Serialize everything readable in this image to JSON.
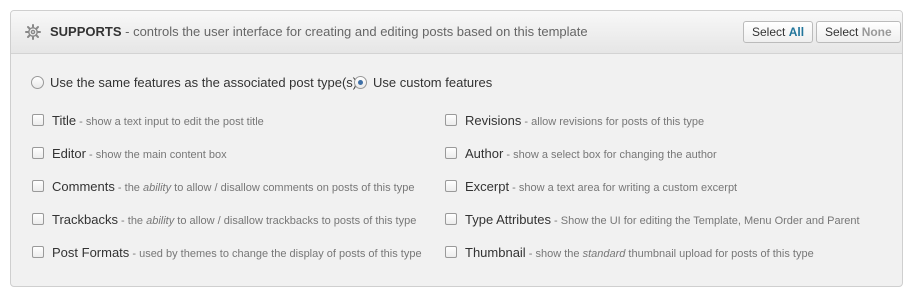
{
  "header": {
    "icon": "gear-icon",
    "title": "SUPPORTS",
    "subtitle": " - controls the user interface for creating and editing posts based on this template",
    "select_all": {
      "prefix": "Select ",
      "accent": "All"
    },
    "select_none": {
      "prefix": "Select ",
      "accent": "None"
    }
  },
  "radios": [
    {
      "label": "Use the same features as the associated post type(s)",
      "checked": false
    },
    {
      "label": "Use custom features",
      "checked": true
    }
  ],
  "options": {
    "title": {
      "label": "Title",
      "desc": " - show a text input to edit the post title"
    },
    "editor": {
      "label": "Editor",
      "desc": " - show the main content box"
    },
    "comments": {
      "label": "Comments",
      "desc_a": " - the ",
      "desc_em": "ability",
      "desc_b": " to allow / disallow comments on posts of this type"
    },
    "trackbacks": {
      "label": "Trackbacks",
      "desc_a": " - the ",
      "desc_em": "ability",
      "desc_b": " to allow / disallow trackbacks to posts of this type"
    },
    "post_formats": {
      "label": "Post Formats",
      "desc": " - used by themes to change the display of posts of this type"
    },
    "revisions": {
      "label": "Revisions",
      "desc": " - allow revisions for posts of this type"
    },
    "author": {
      "label": "Author",
      "desc": " - show a select box for changing the author"
    },
    "excerpt": {
      "label": "Excerpt",
      "desc": " - show a text area for writing a custom excerpt"
    },
    "type_attributes": {
      "label": "Type Attributes",
      "desc": " - Show the UI for editing the Template, Menu Order and Parent"
    },
    "thumbnail": {
      "label": "Thumbnail",
      "desc_a": " - show the ",
      "desc_em": "standard",
      "desc_b": " thumbnail upload for posts of this type"
    }
  },
  "colors": {
    "accent_blue": "#21759b",
    "radio_dot": "#3e6fa6",
    "panel_bg": "#f1f1f1"
  }
}
